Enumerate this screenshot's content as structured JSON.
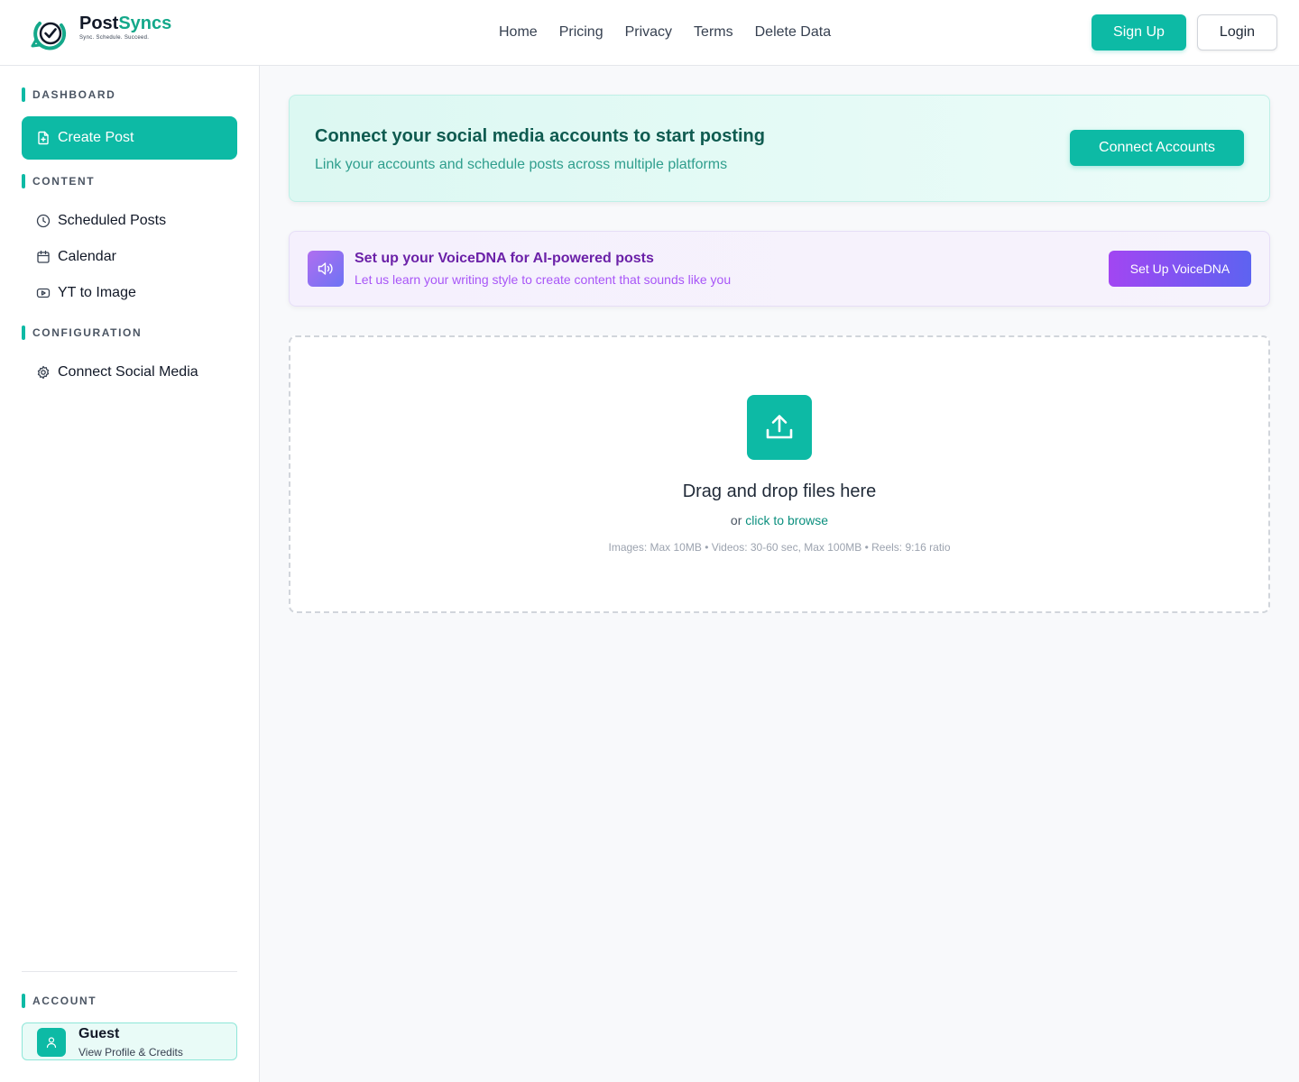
{
  "brand": {
    "name_part1": "Post",
    "name_part2": "Syncs",
    "tagline": "Sync. Schedule. Succeed.",
    "accent_color": "#0dbaa5"
  },
  "header": {
    "nav": [
      "Home",
      "Pricing",
      "Privacy",
      "Terms",
      "Delete Data"
    ],
    "signup_label": "Sign Up",
    "login_label": "Login"
  },
  "sidebar": {
    "sections": {
      "dashboard": "DASHBOARD",
      "content": "CONTENT",
      "configuration": "CONFIGURATION",
      "account": "ACCOUNT"
    },
    "create_post": {
      "label": "Create Post",
      "icon": "file-plus-icon",
      "active": true
    },
    "content_items": [
      {
        "label": "Scheduled Posts",
        "icon": "clock-icon"
      },
      {
        "label": "Calendar",
        "icon": "calendar-icon"
      },
      {
        "label": "YT to Image",
        "icon": "youtube-icon"
      }
    ],
    "config_items": [
      {
        "label": "Connect Social Media",
        "icon": "gear-icon"
      }
    ],
    "account": {
      "name": "Guest",
      "subtitle": "View Profile & Credits",
      "icon": "user-icon"
    }
  },
  "main": {
    "connect_banner": {
      "title": "Connect your social media accounts to start posting",
      "subtitle": "Link your accounts and schedule posts across multiple platforms",
      "button": "Connect Accounts"
    },
    "voice_banner": {
      "title": "Set up your VoiceDNA for AI-powered posts",
      "subtitle": "Let us learn your writing style to create content that sounds like you",
      "button": "Set Up VoiceDNA",
      "icon": "speaker-icon"
    },
    "dropzone": {
      "title": "Drag and drop files here",
      "or_text": "or",
      "browse_link": "click to browse",
      "hint": "Images: Max 10MB • Videos: 30-60 sec, Max 100MB • Reels: 9:16 ratio",
      "icon": "upload-icon"
    }
  }
}
